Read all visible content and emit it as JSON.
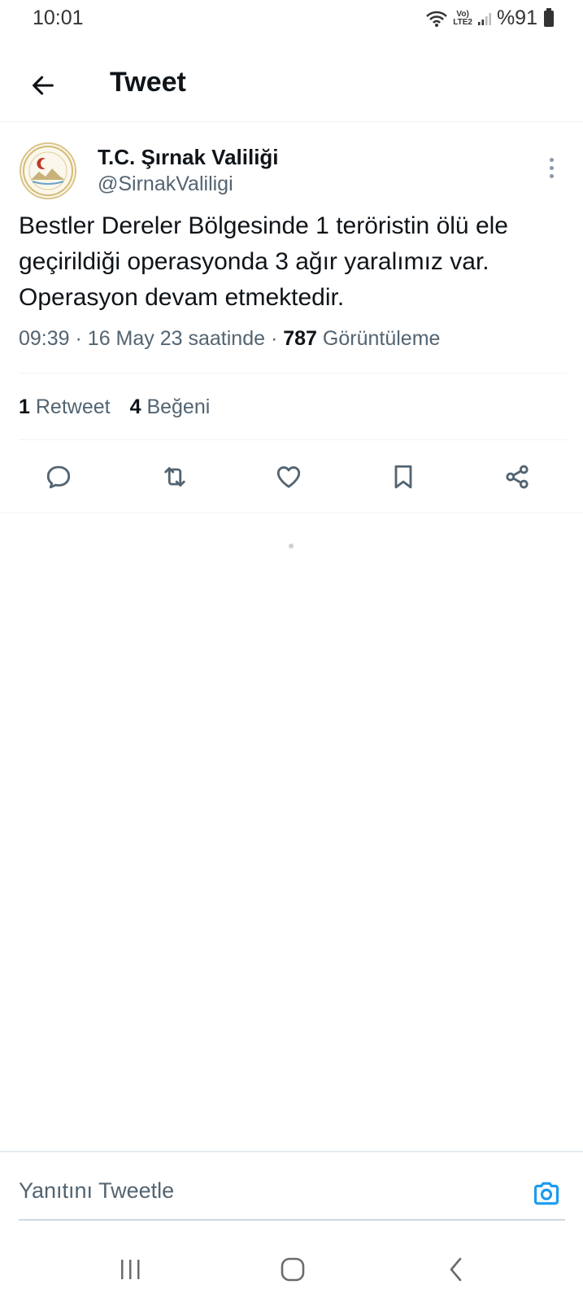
{
  "status_bar": {
    "time": "10:01",
    "network_top": "Vo)",
    "network_bottom": "LTE2",
    "battery": "%91"
  },
  "header": {
    "title": "Tweet"
  },
  "tweet": {
    "author_name": "T.C. Şırnak Valiliği",
    "author_handle": "@SirnakValiligi",
    "text": "Bestler Dereler Bölgesinde 1 teröristin ölü ele geçirildiği operasyonda 3 ağır yaralımız var. Operasyon devam etmektedir.",
    "time": "09:39",
    "date": "16 May 23 saatinde",
    "views_count": "787",
    "views_label": "Görüntüleme",
    "retweets_count": "1",
    "retweets_label": "Retweet",
    "likes_count": "4",
    "likes_label": "Beğeni"
  },
  "actions": [
    "reply-icon",
    "retweet-icon",
    "like-icon",
    "bookmark-icon",
    "share-icon"
  ],
  "reply_bar": {
    "placeholder": "Yanıtını Tweetle"
  },
  "colors": {
    "accent": "#1d9bf0",
    "text_primary": "#0f1419",
    "text_secondary": "#536471",
    "icon": "#536471"
  }
}
